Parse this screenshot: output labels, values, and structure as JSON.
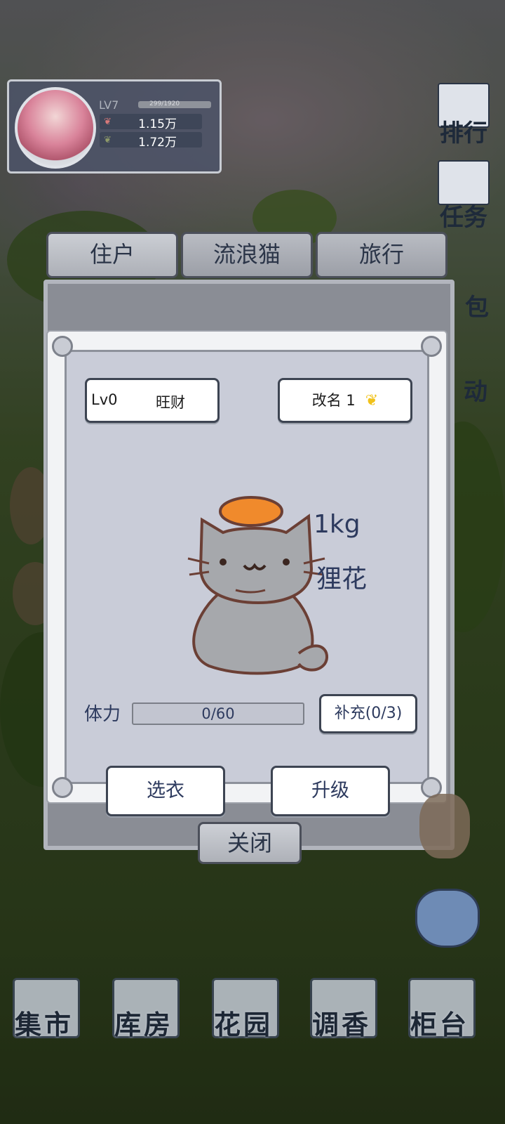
{
  "player": {
    "level": "LV7",
    "xp": "299/1920",
    "currency1": "1.15万",
    "currency2": "1.72万"
  },
  "side_menu": [
    "排行",
    "任务",
    "包",
    "动"
  ],
  "tabs": [
    "住户",
    "流浪猫",
    "旅行"
  ],
  "cat": {
    "level": "Lv0",
    "name": "旺财",
    "rename_label": "改名 1",
    "weight": "1kg",
    "breed": "狸花",
    "stamina_label": "体力",
    "stamina_text": "0/60",
    "stamina_fraction": 0,
    "refill_label": "补充(0/3)"
  },
  "actions": {
    "dress": "选衣",
    "upgrade": "升级",
    "close": "关闭"
  },
  "bottom_nav": [
    "集市",
    "库房",
    "花园",
    "调香",
    "柜台"
  ],
  "colors": {
    "text_primary": "#2d3a5e",
    "panel_bg": "#c9ccd8",
    "coin": "#f1c21b"
  }
}
